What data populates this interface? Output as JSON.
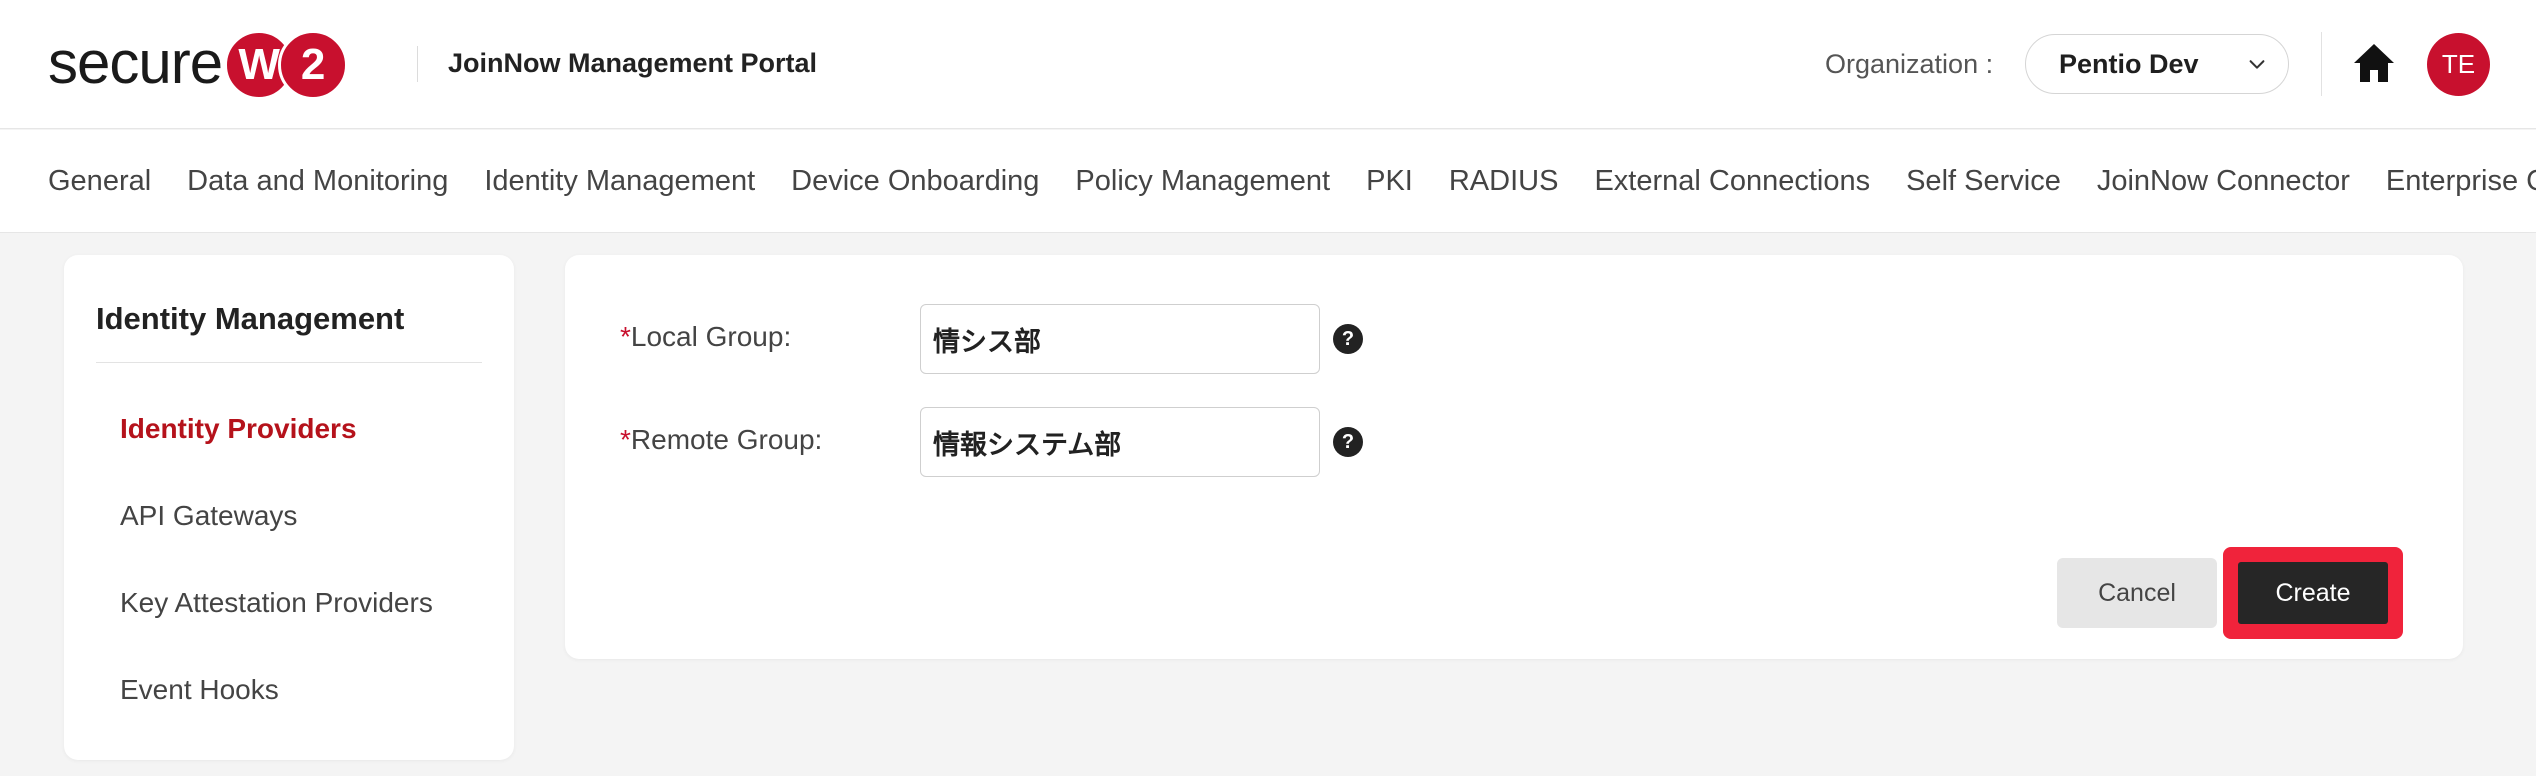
{
  "header": {
    "logo": {
      "word": "secure",
      "badge_left": "W",
      "badge_right": "2"
    },
    "portal_title": "JoinNow Management Portal",
    "org_label": "Organization :",
    "org_value": "Pentio Dev",
    "avatar_initials": "TE",
    "brand_color": "#c8102e"
  },
  "topnav": {
    "items": [
      "General",
      "Data and Monitoring",
      "Identity Management",
      "Device Onboarding",
      "Policy Management",
      "PKI",
      "RADIUS",
      "External Connections",
      "Self Service",
      "JoinNow Connector",
      "Enterprise Client"
    ]
  },
  "sidebar": {
    "title": "Identity Management",
    "items": [
      {
        "label": "Identity Providers",
        "active": true
      },
      {
        "label": "API Gateways",
        "active": false
      },
      {
        "label": "Key Attestation Providers",
        "active": false
      },
      {
        "label": "Event Hooks",
        "active": false
      }
    ]
  },
  "form": {
    "required_mark": "*",
    "local_group": {
      "label": "Local Group:",
      "value": "情シス部"
    },
    "remote_group": {
      "label": "Remote Group:",
      "value": "情報システム部"
    },
    "help_glyph": "?",
    "cancel_label": "Cancel",
    "create_label": "Create",
    "highlight_color": "#f0233b"
  }
}
